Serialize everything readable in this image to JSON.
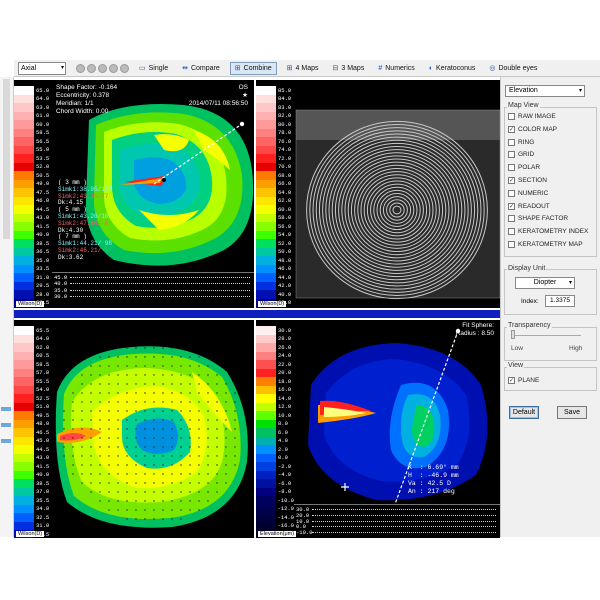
{
  "toolbar": {
    "map_select": "Axial",
    "buttons": [
      {
        "label": "Single",
        "glyph": "▭"
      },
      {
        "label": "Compare",
        "glyph": "⇹"
      },
      {
        "label": "Combine",
        "glyph": "⊞",
        "selected": true
      },
      {
        "label": "4 Maps",
        "glyph": "⊞"
      },
      {
        "label": "3 Maps",
        "glyph": "⊟"
      },
      {
        "label": "Numerics",
        "glyph": "#"
      },
      {
        "label": "Keratoconus",
        "glyph": "◐"
      },
      {
        "label": "Double eyes",
        "glyph": "◎"
      }
    ]
  },
  "scale_tl": [
    "65.0",
    "64.0",
    "63.0",
    "61.0",
    "60.0",
    "58.5",
    "56.5",
    "55.0",
    "53.5",
    "52.0",
    "50.5",
    "49.0",
    "47.5",
    "46.0",
    "44.5",
    "43.0",
    "41.5",
    "40.0",
    "38.5",
    "36.5",
    "35.0",
    "33.5",
    "31.0",
    "29.5",
    "28.0",
    "26.5",
    "25.5"
  ],
  "scale_bl": [
    "65.5",
    "64.0",
    "62.0",
    "60.5",
    "58.5",
    "57.0",
    "55.5",
    "54.0",
    "52.5",
    "51.0",
    "49.5",
    "48.0",
    "46.5",
    "45.0",
    "44.5",
    "43.0",
    "41.5",
    "40.0",
    "38.5",
    "37.0",
    "35.5",
    "34.0",
    "32.5",
    "31.0",
    "29.5",
    "28.0",
    "26.5",
    "25.0"
  ],
  "scale_tr": [
    "85.0",
    "84.0",
    "83.0",
    "82.0",
    "80.0",
    "78.0",
    "76.0",
    "74.0",
    "72.0",
    "70.0",
    "68.0",
    "66.0",
    "64.0",
    "62.0",
    "60.0",
    "58.0",
    "56.0",
    "54.0",
    "52.0",
    "50.0",
    "48.0",
    "46.0",
    "44.0",
    "42.0",
    "40.0",
    "38.0",
    "36.0"
  ],
  "scale_br": [
    "30.0",
    "28.0",
    "26.0",
    "24.0",
    "22.0",
    "20.0",
    "18.0",
    "16.0",
    "14.0",
    "12.0",
    "10.0",
    "8.0",
    "6.0",
    "4.0",
    "2.0",
    "0.0",
    "-2.0",
    "-4.0",
    "-6.0",
    "-8.0",
    "-10.0",
    "-12.0",
    "-14.0",
    "-16.0",
    "-18.0",
    "-20.0",
    "-22.0"
  ],
  "scale_tl_colors": [
    "#ffffff",
    "#ffdede",
    "#ffc8c8",
    "#ffb0b0",
    "#ff9a9a",
    "#ff8080",
    "#ff6464",
    "#ff4646",
    "#ff2020",
    "#e60000",
    "#ff7a00",
    "#ff9e00",
    "#ffc400",
    "#ffe600",
    "#f4ff00",
    "#c4ff00",
    "#86ff00",
    "#3cff00",
    "#00e060",
    "#00c8a0",
    "#00b0e0",
    "#0090ff",
    "#0060ff",
    "#0030e0",
    "#0010b0",
    "#000090",
    "#000060"
  ],
  "scale_br_colors": [
    "#fff0f0",
    "#ffcccc",
    "#ffa8a8",
    "#ff8080",
    "#ff5050",
    "#ff2020",
    "#ff8000",
    "#ffc000",
    "#ffff00",
    "#c0ff00",
    "#60ff00",
    "#00e000",
    "#00c060",
    "#00b0b0",
    "#0090ff",
    "#0060ff",
    "#0040e0",
    "#0020c0",
    "#0010a0",
    "#000080",
    "#000060",
    "#000050",
    "#000040",
    "#000030",
    "#000020",
    "#000010",
    "#000000"
  ],
  "tl": {
    "info_left": "Shape Factor: -0.164\nEccentricity: 0.378\nMeridian: 1/1\nChord Width: 0.00",
    "info_right": "OS\n★\n2014/07/11 08:56:50",
    "readout": [
      {
        "t": "( 3 mm )",
        "c": "w"
      },
      {
        "t": "Simk1:38.95/167",
        "c": "c"
      },
      {
        "t": "Simk2:43.15/77",
        "c": "r"
      },
      {
        "t": "Dk:4.15",
        "c": "w"
      },
      {
        "t": "( 5 mm )",
        "c": "w"
      },
      {
        "t": "Simk1:43.20/166",
        "c": "c"
      },
      {
        "t": "Simk2:47.60/ 6",
        "c": "r"
      },
      {
        "t": "Dk:4.30",
        "c": "w"
      },
      {
        "t": "( 7 mm )",
        "c": "w"
      },
      {
        "t": "Simk1:44.21/ 98",
        "c": "c"
      },
      {
        "t": "Simk2:46.21/ 6",
        "c": "r"
      },
      {
        "t": "Dk:3.62",
        "c": "w"
      }
    ],
    "scale_name": "Wilson(D)",
    "graph_vals": [
      "45.0",
      "40.0",
      "35.0",
      "30.0"
    ]
  },
  "tr": {
    "scale_name": "Wilson(D)"
  },
  "sep_caption": "",
  "bl": {
    "scale_name": "Wilson(D)"
  },
  "br": {
    "info_right": "Fit Sphere:\nRadius : 8.50",
    "readout": "K  : 6.69° mm\nH  : -46.9 mm\nVa : 42.5 D\nAn : 217 deg",
    "scale_name": "Elevation(μm)",
    "graph_vals": [
      "30.0",
      "20.0",
      "10.0",
      "0.0",
      "-10.0"
    ]
  },
  "sidebar": {
    "elev_select": "Elevation",
    "map_view_title": "Map View",
    "map_view_items": [
      {
        "label": "RAW IMAGE",
        "checked": false
      },
      {
        "label": "COLOR MAP",
        "checked": true
      },
      {
        "label": "RING",
        "checked": false
      },
      {
        "label": "GRID",
        "checked": false
      },
      {
        "label": "POLAR",
        "checked": false
      },
      {
        "label": "SECTION",
        "checked": true
      },
      {
        "label": "NUMERIC",
        "checked": false
      },
      {
        "label": "READOUT",
        "checked": true
      },
      {
        "label": "SHAPE FACTOR",
        "checked": false
      },
      {
        "label": "KERATOMETRY INDEX",
        "checked": false
      },
      {
        "label": "KERATOMETRY MAP",
        "checked": false
      }
    ],
    "display_unit_title": "Display Unit",
    "display_unit": "Diopter",
    "index_label": "Index:",
    "index_value": "1.3375",
    "transparency_title": "Transparency",
    "slider_low": "Low",
    "slider_high": "High",
    "view_title": "View",
    "view_item": {
      "label": "PLANE",
      "checked": true
    },
    "default_button": "Default",
    "save_button": "Save"
  }
}
